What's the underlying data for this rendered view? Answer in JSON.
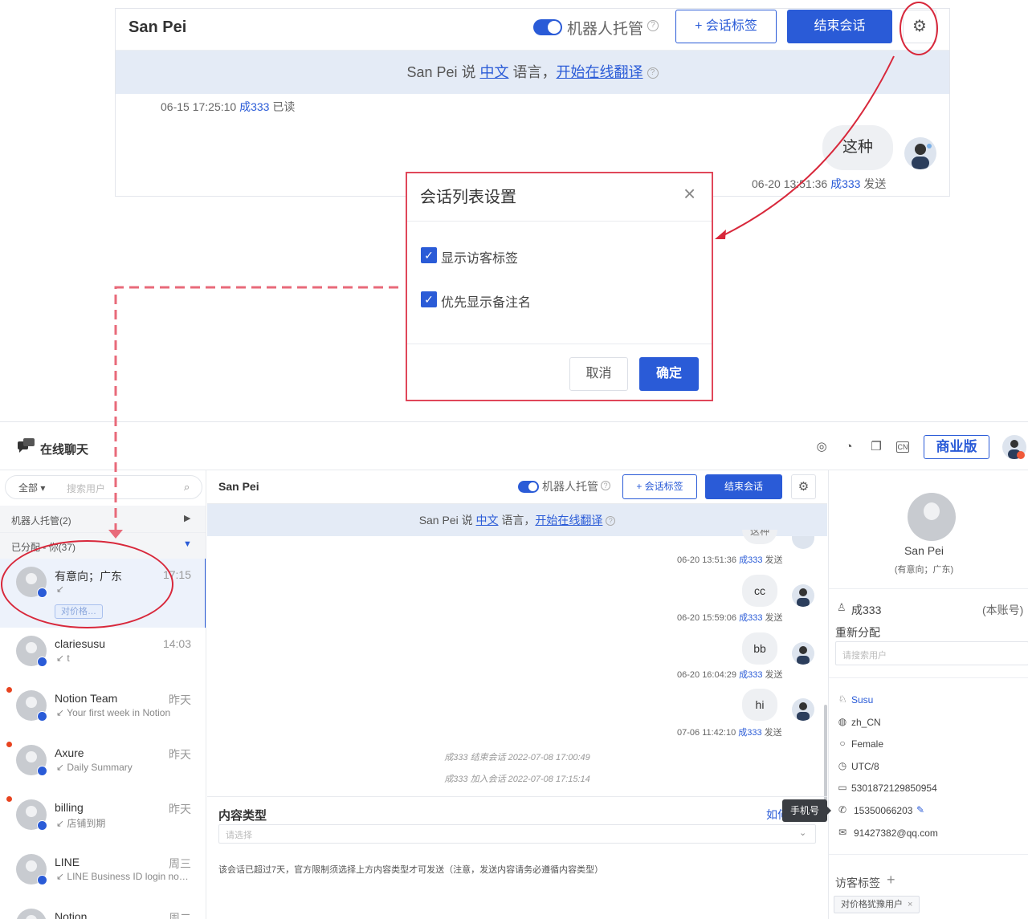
{
  "top_panel": {
    "name": "San Pei",
    "robot_label": "机器人托管",
    "tag_button": "+ 会话标签",
    "end_button": "结束会话",
    "banner": {
      "prefix": "San Pei 说 ",
      "lang": "中文",
      "mid": " 语言，",
      "link": "开始在线翻译"
    },
    "time1_prefix": "06-15 17:25:10  ",
    "time1_agent": "成333",
    "time1_suffix": " 已读",
    "bubble": "这种",
    "time2_prefix": "06-20 13:51:36  ",
    "time2_agent": "成333",
    "time2_suffix": " 发送"
  },
  "dialog": {
    "title": "会话列表设置",
    "option1": "显示访客标签",
    "option2": "优先显示备注名",
    "cancel": "取消",
    "ok": "确定"
  },
  "app": {
    "title": "在线聊天",
    "pro_label": "商业版"
  },
  "sidebar": {
    "filter": "全部",
    "search_placeholder": "搜索用户",
    "robot_group": "机器人托管(2)",
    "assigned_group": "已分配 - 你(37)",
    "conversations": [
      {
        "name": "有意向；广东",
        "time": "17:15",
        "sub": "",
        "tag": "对价格…"
      },
      {
        "name": "clariesusu",
        "time": "14:03",
        "sub": "t"
      },
      {
        "name": "Notion Team",
        "time": "昨天",
        "sub": "Your first week in Notion"
      },
      {
        "name": "Axure",
        "time": "昨天",
        "sub": "Daily Summary"
      },
      {
        "name": "billing",
        "time": "昨天",
        "sub": "店铺到期"
      },
      {
        "name": "LINE",
        "time": "周三",
        "sub": "LINE Business ID login noti…"
      },
      {
        "name": "Notion",
        "time": "周二",
        "sub": ""
      }
    ]
  },
  "chat": {
    "name": "San Pei",
    "robot_label": "机器人托管",
    "tag_button": "+ 会话标签",
    "end_button": "结束会话",
    "banner": {
      "prefix": "San Pei 说 ",
      "lang": "中文",
      "mid": " 语言，",
      "link": "开始在线翻译"
    },
    "partial_bubble": "这种",
    "messages": [
      {
        "meta_prefix": "06-20 13:51:36  ",
        "agent": "成333",
        "suffix": " 发送"
      },
      {
        "bubble": "cc",
        "meta_prefix": "06-20 15:59:06  ",
        "agent": "成333",
        "suffix": " 发送"
      },
      {
        "bubble": "bb",
        "meta_prefix": "06-20 16:04:29  ",
        "agent": "成333",
        "suffix": " 发送"
      },
      {
        "bubble": "hi",
        "meta_prefix": "07-06 11:42:10  ",
        "agent": "成333",
        "suffix": " 发送"
      }
    ],
    "system1": "成333 结束会话 2022-07-08 17:00:49",
    "system2": "成333 加入会话 2022-07-08 17:15:14",
    "content_type_label": "内容类型",
    "howto": "如何",
    "select_placeholder": "请选择",
    "note": "该会话已超过7天，官方限制须选择上方内容类型才可发送（注意，发送内容请务必遵循内容类型）"
  },
  "right_panel": {
    "name": "San Pei",
    "intent": "(有意向；广东)",
    "agent": "成333",
    "own": "(本账号)",
    "reassign": "重新分配",
    "search_placeholder": "请搜索用户",
    "details": {
      "source": "Susu",
      "lang": "zh_CN",
      "gender": "Female",
      "tz": "UTC/8",
      "id": "5301872129850954",
      "phone": "15350066203",
      "email": "91427382@qq.com"
    },
    "tooltip": "手机号",
    "tag_header": "访客标签",
    "tag": "对价格犹豫用户"
  }
}
